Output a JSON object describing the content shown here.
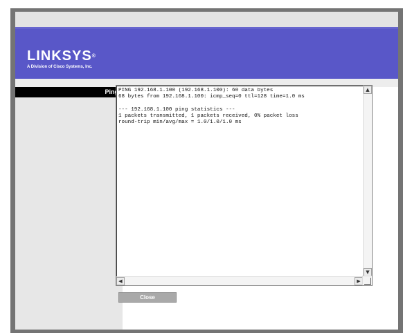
{
  "header": {
    "brand": "LINKSYS",
    "trademark": "®",
    "tagline": "A Division of Cisco Systems, Inc."
  },
  "nav": {
    "active_label": "Ping"
  },
  "ping_output": {
    "lines": [
      "PING 192.168.1.100 (192.168.1.100): 60 data bytes",
      "68 bytes from 192.168.1.100: icmp_seq=0 ttl=128 time=1.0 ms",
      "",
      "--- 192.168.1.100 ping statistics ---",
      "1 packets transmitted, 1 packets received, 0% packet loss",
      "round-trip min/avg/max = 1.0/1.0/1.0 ms"
    ]
  },
  "buttons": {
    "close_label": "Close"
  },
  "colors": {
    "header_blue": "#5957c8",
    "nav_black": "#000000",
    "button_gray": "#a9a9a9"
  }
}
